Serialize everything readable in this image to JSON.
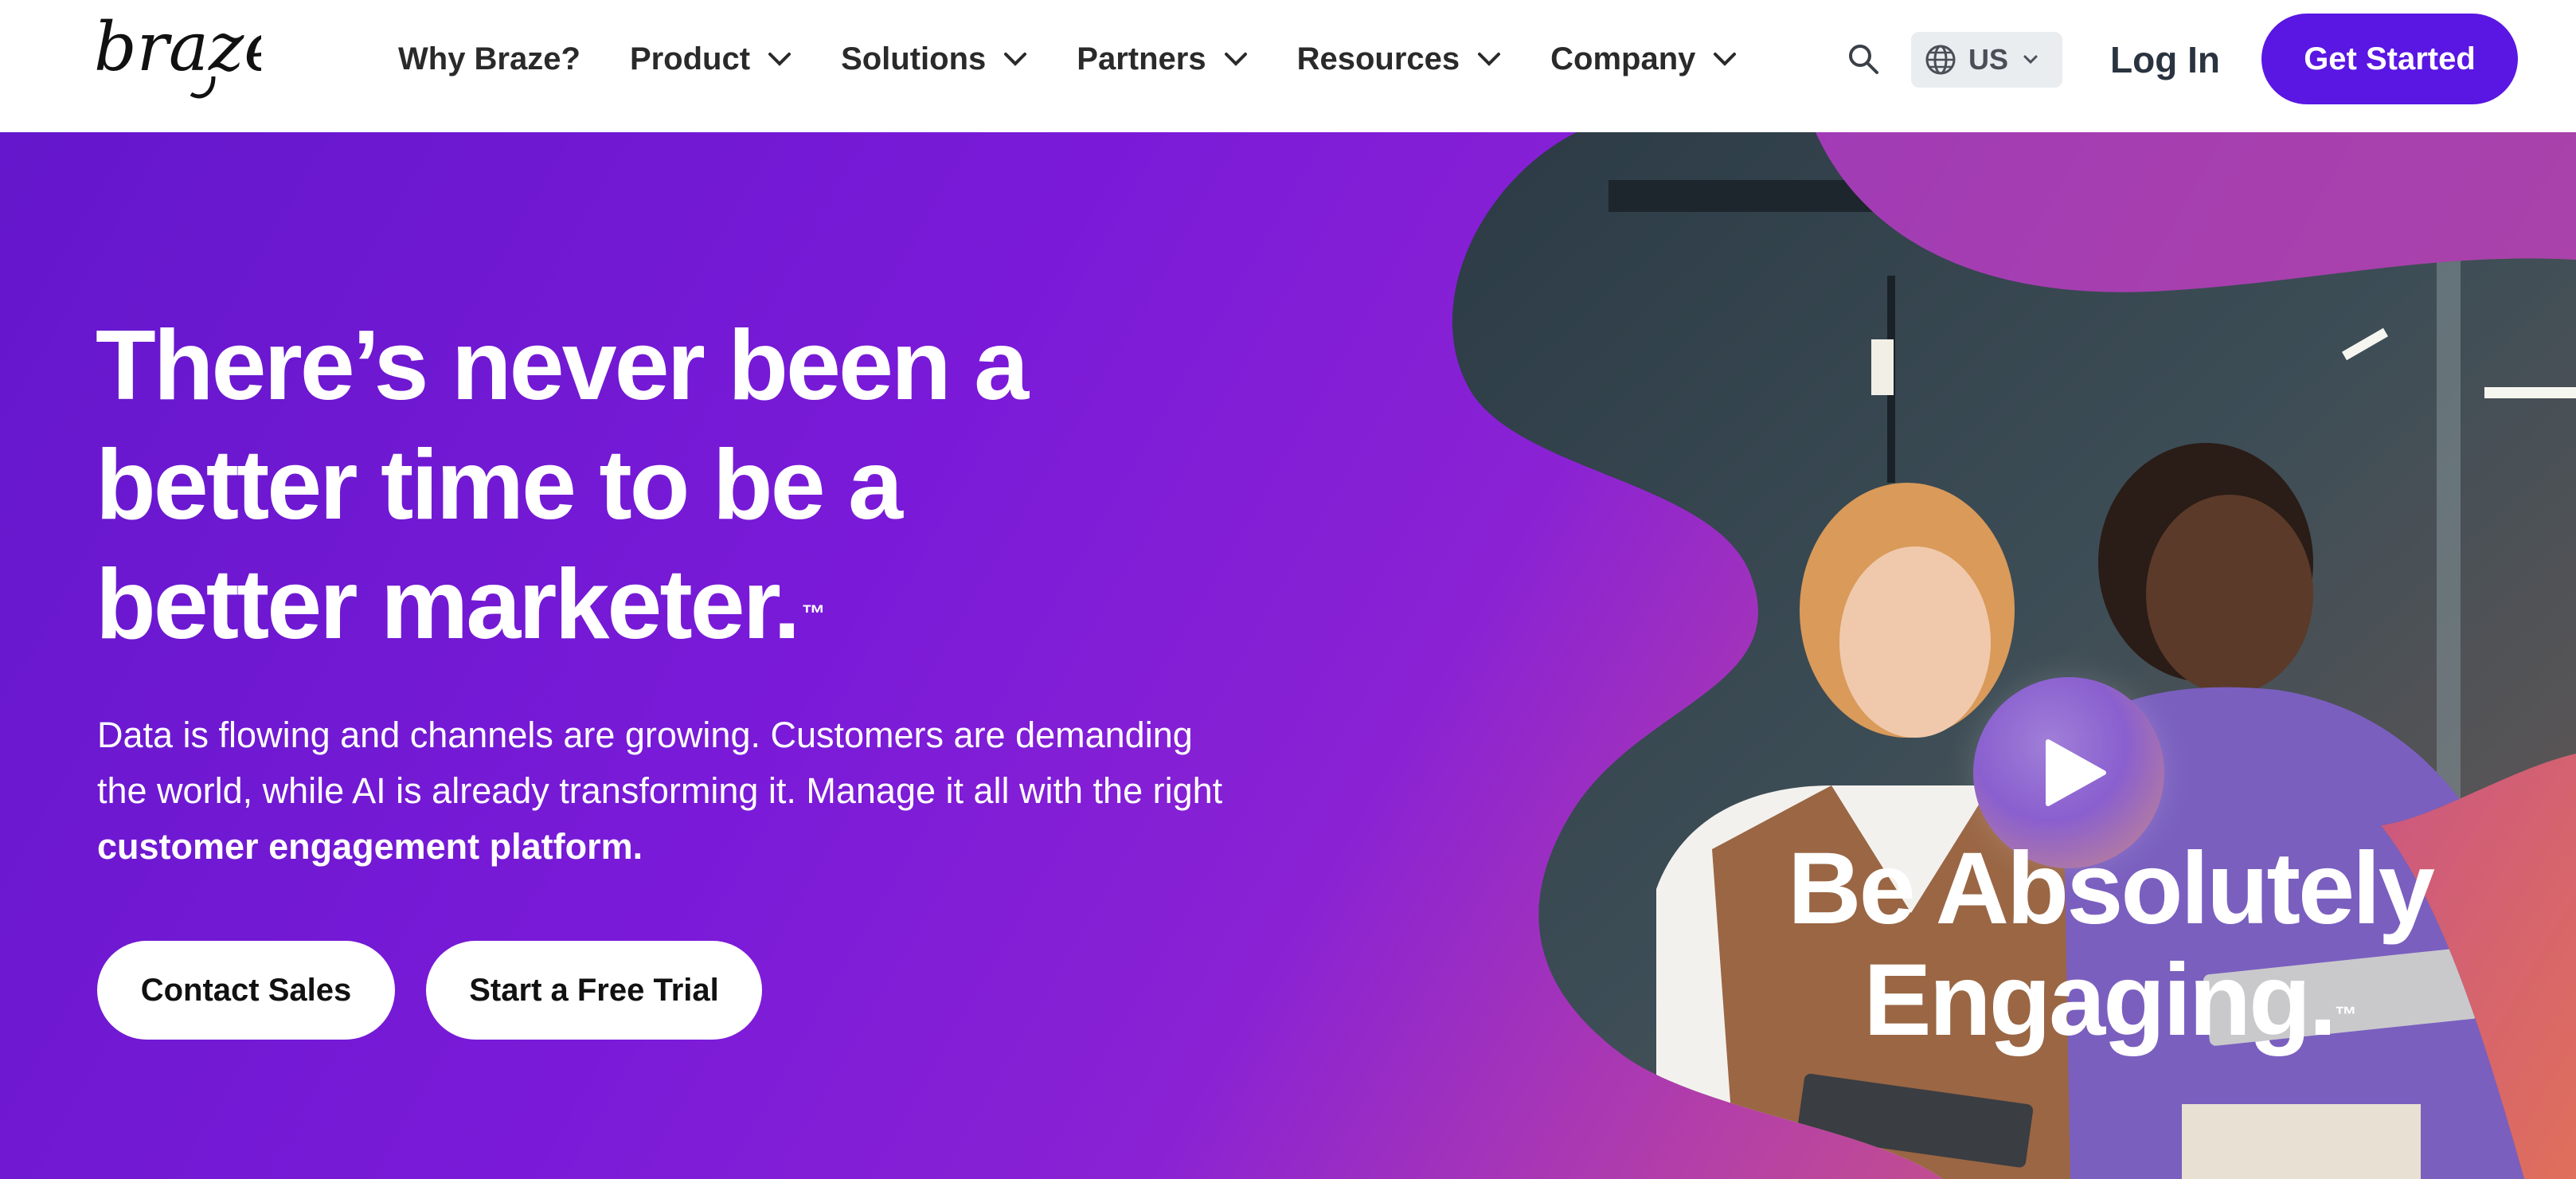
{
  "brand": {
    "logo_text": "braze",
    "accent": "#5a16e3"
  },
  "nav": {
    "items": [
      {
        "label": "Why Braze?",
        "has_dropdown": false
      },
      {
        "label": "Product",
        "has_dropdown": true
      },
      {
        "label": "Solutions",
        "has_dropdown": true
      },
      {
        "label": "Partners",
        "has_dropdown": true
      },
      {
        "label": "Resources",
        "has_dropdown": true
      },
      {
        "label": "Company",
        "has_dropdown": true
      }
    ],
    "search_icon": "search-icon",
    "locale": {
      "icon": "globe-icon",
      "value": "US"
    },
    "login_label": "Log In",
    "get_started_label": "Get Started"
  },
  "hero": {
    "headline_lines": [
      "There’s never been a",
      "better time to be a",
      "better marketer."
    ],
    "headline_tm": "™",
    "subcopy_plain": "Data is flowing and channels are growing. Customers are demanding the world, while AI is already transforming it. Manage it all with the right ",
    "subcopy_strong": "customer engagement platform.",
    "cta_primary": "Contact Sales",
    "cta_secondary": "Start a Free Trial",
    "video": {
      "play_icon": "play-icon",
      "tagline_lines": [
        "Be Absolutely",
        "Engaging."
      ],
      "tagline_tm": "™"
    },
    "colors": {
      "gradient_start": "#6417cc",
      "gradient_end": "#e06f5b"
    }
  }
}
